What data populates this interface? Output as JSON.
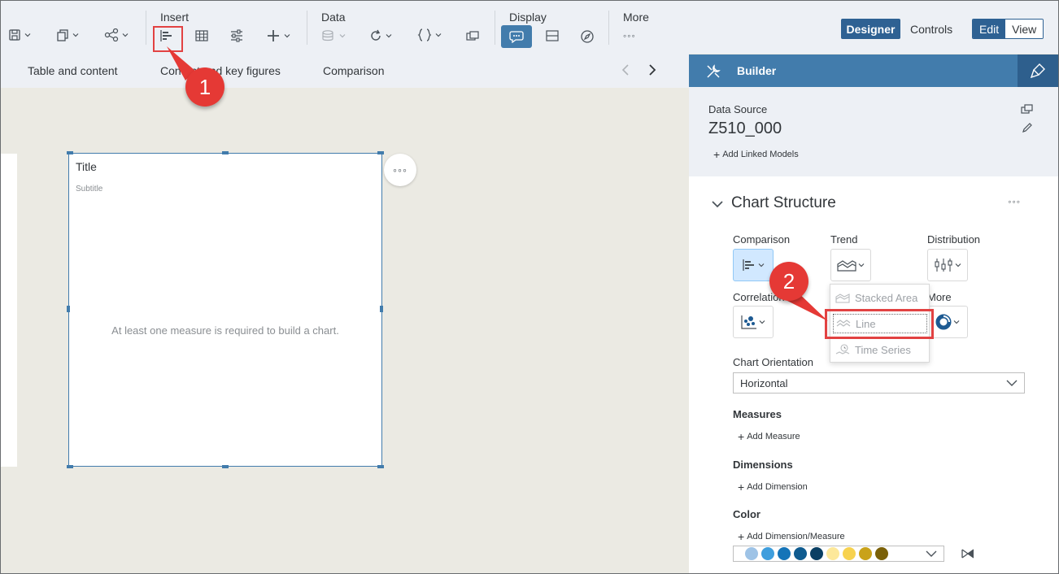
{
  "toolbar": {
    "groups": {
      "insert": "Insert",
      "data": "Data",
      "display": "Display",
      "more": "More"
    },
    "more_dots": "◦◦◦",
    "designer": "Designer",
    "controls": "Controls",
    "edit": "Edit",
    "view": "View"
  },
  "subbar": {
    "tabs": [
      "Table and content",
      "Content and key figures",
      "Comparison"
    ]
  },
  "canvas": {
    "chart": {
      "title": "Title",
      "subtitle": "Subtitle",
      "message": "At least one measure is required to build a chart."
    },
    "more_dots": "◦◦◦"
  },
  "callouts": {
    "one": "1",
    "two": "2"
  },
  "builder": {
    "header": "Builder",
    "data_source_label": "Data Source",
    "data_source_name": "Z510_000",
    "add_linked_models": "Add Linked Models",
    "chart_structure": "Chart Structure",
    "section_dots": "◦◦◦",
    "chart_groups": {
      "comparison": "Comparison",
      "trend": "Trend",
      "distribution": "Distribution",
      "correlation": "Correlation",
      "more": "More"
    },
    "chart_orientation_label": "Chart Orientation",
    "chart_orientation_value": "Horizontal",
    "measures_label": "Measures",
    "add_measure": "Add Measure",
    "dimensions_label": "Dimensions",
    "add_dimension": "Add Dimension",
    "color_label": "Color",
    "add_dimension_measure": "Add Dimension/Measure",
    "palette": [
      "#9ec3e6",
      "#3f9edd",
      "#1574b8",
      "#0f5b8f",
      "#0a3f63",
      "#fde89a",
      "#f7d24f",
      "#c9a21a",
      "#7a6008"
    ]
  },
  "trend_menu": {
    "options": [
      "Stacked Area",
      "Line",
      "Time Series"
    ]
  }
}
